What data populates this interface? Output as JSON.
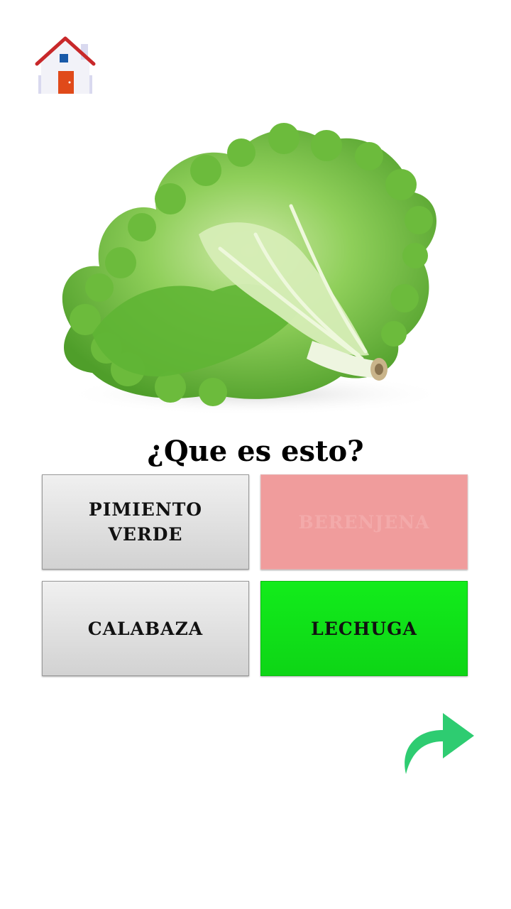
{
  "header": {
    "home_icon": "house-icon"
  },
  "image": {
    "subject_icon": "lettuce-image"
  },
  "question": "¿Que es esto?",
  "options": [
    {
      "label": "PIMIENTO VERDE",
      "state": "neutral"
    },
    {
      "label": "BERENJENA",
      "state": "wrong"
    },
    {
      "label": "CALABAZA",
      "state": "neutral"
    },
    {
      "label": "LECHUGA",
      "state": "correct"
    }
  ],
  "footer": {
    "next_icon": "forward-arrow-icon"
  },
  "colors": {
    "correct": "#12ec1b",
    "wrong": "#f09c9c",
    "neutral": "#e2e2e2",
    "arrow": "#2ecc71"
  }
}
